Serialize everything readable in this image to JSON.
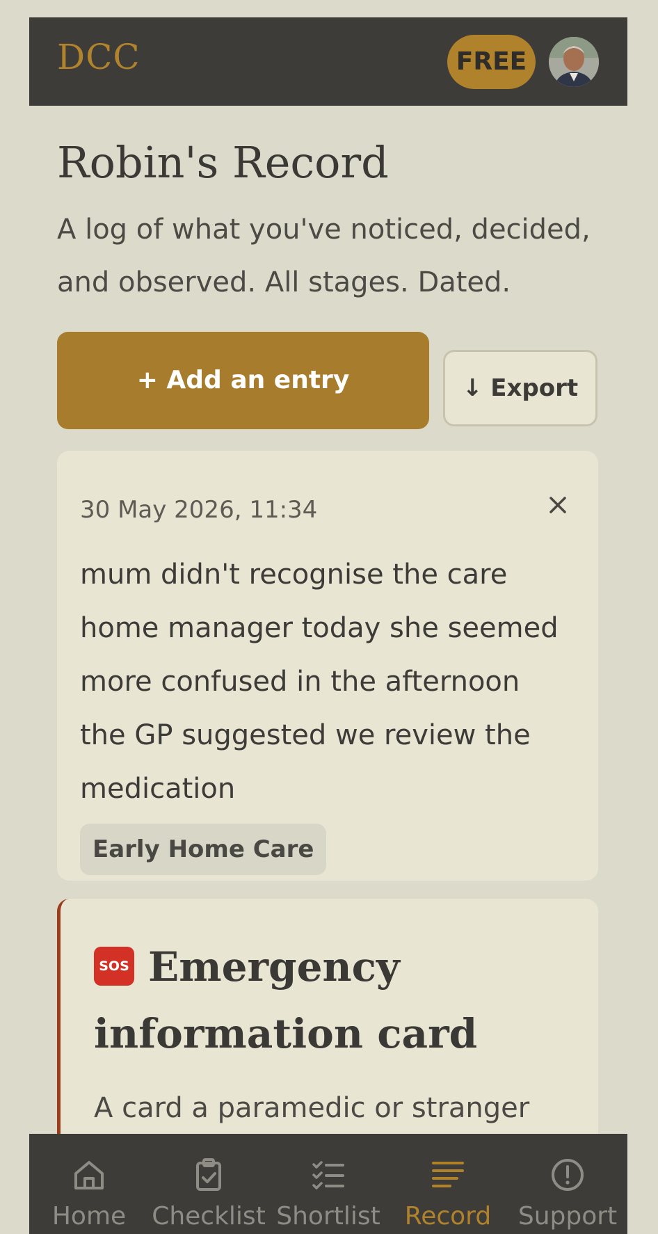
{
  "header": {
    "logo": "DCC",
    "plan_badge": "FREE"
  },
  "page": {
    "title": "Robin's Record",
    "subtitle": "A log of what you've noticed, decided, and observed. All stages. Dated."
  },
  "actions": {
    "add_label": "+ Add an entry",
    "export_label": "↓ Export"
  },
  "entries": [
    {
      "date": "30 May 2026, 11:34",
      "text": "mum didn't recognise the care home manager today she seemed more confused in the afternoon the GP suggested we review the medication",
      "tag": "Early Home Care"
    }
  ],
  "emergency_card": {
    "icon": "sos-icon",
    "icon_text": "SOS",
    "title": "Emergency information card",
    "description": "A card a paramedic or stranger"
  },
  "nav": {
    "items": [
      {
        "label": "Home",
        "icon": "home-icon"
      },
      {
        "label": "Checklist",
        "icon": "clipboard-check-icon"
      },
      {
        "label": "Shortlist",
        "icon": "checklist-icon"
      },
      {
        "label": "Record",
        "icon": "record-lines-icon",
        "active": true
      },
      {
        "label": "Support",
        "icon": "alert-circle-icon"
      }
    ]
  },
  "colors": {
    "background": "#dcdbcb",
    "header": "#3d3c39",
    "accent": "#a77c2c",
    "card": "#e8e5d2",
    "emergency_border": "#9a3d1c"
  }
}
